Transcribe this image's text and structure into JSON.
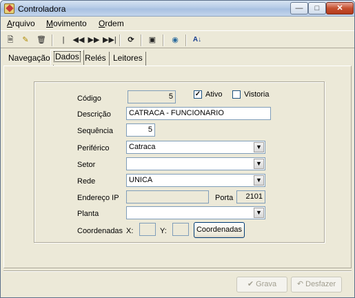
{
  "window": {
    "title": "Controladora"
  },
  "menu": [
    "Arquivo",
    "Movimento",
    "Ordem"
  ],
  "menu_underline": [
    "A",
    "M",
    "O"
  ],
  "toolbar": [
    {
      "icon": "new-document-icon"
    },
    {
      "icon": "edit-icon"
    },
    {
      "icon": "delete-icon"
    },
    {
      "icon": "first-record-icon"
    },
    {
      "icon": "previous-record-icon"
    },
    {
      "icon": "next-record-icon"
    },
    {
      "icon": "last-record-icon"
    },
    {
      "icon": "refresh-icon"
    },
    {
      "icon": "properties-icon"
    },
    {
      "icon": "report-icon"
    },
    {
      "icon": "sort-az-icon"
    }
  ],
  "tabs": [
    "Navegação",
    "Dados",
    "Relés",
    "Leitores"
  ],
  "active_tab": "Dados",
  "form": {
    "codigo_label": "Código",
    "codigo_value": "5",
    "ativo_label": "Ativo",
    "ativo_checked": true,
    "vistoria_label": "Vistoria",
    "vistoria_checked": false,
    "descricao_label": "Descrição",
    "descricao_value": "CATRACA - FUNCIONARIO",
    "sequencia_label": "Sequência",
    "sequencia_value": "5",
    "periferico_label": "Periférico",
    "periferico_value": "Catraca",
    "setor_label": "Setor",
    "setor_value": "",
    "rede_label": "Rede",
    "rede_value": "UNICA",
    "endereco_ip_label": "Endereço IP",
    "endereco_ip_value": "",
    "porta_label": "Porta",
    "porta_value": "2101",
    "planta_label": "Planta",
    "planta_value": "",
    "coordenadas_label": "Coordenadas",
    "x_label": "X:",
    "x_value": "",
    "y_label": "Y:",
    "y_value": "",
    "coordenadas_button": "Coordenadas"
  },
  "footer": {
    "grava_label": "Grava",
    "desfazer_label": "Desfazer"
  }
}
